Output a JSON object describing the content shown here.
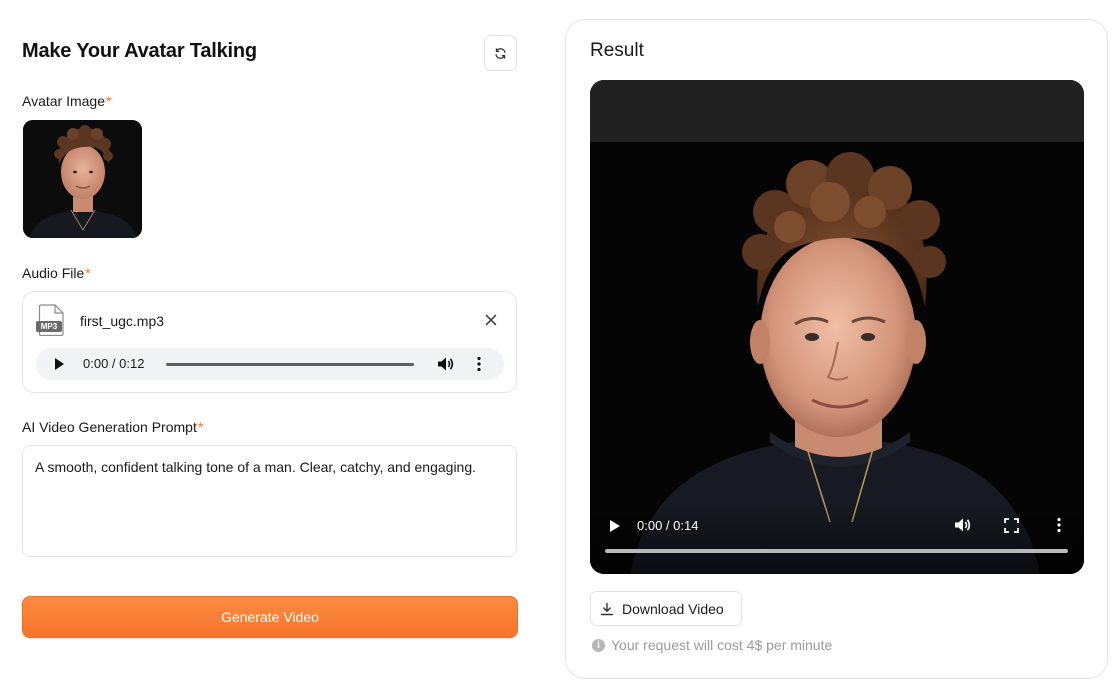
{
  "form": {
    "title": "Make Your Avatar Talking",
    "avatar_label": "Avatar Image",
    "audio_label": "Audio File",
    "prompt_label": "AI Video Generation Prompt",
    "required_mark": "*",
    "audio": {
      "file_name": "first_ugc.mp3",
      "file_badge": "MP3",
      "time": "0:00 / 0:12"
    },
    "prompt_value": "A smooth, confident talking tone of a man. Clear, catchy, and engaging.",
    "generate_label": "Generate Video"
  },
  "result": {
    "title": "Result",
    "video_time": "0:00 / 0:14",
    "download_label": "Download Video",
    "cost_icon": "i",
    "cost_text": "Your request will cost 4$ per minute"
  },
  "colors": {
    "accent": "#f57a2c",
    "button_gradient_top": "#fd8b43",
    "button_gradient_bottom": "#f5742a"
  },
  "icons": [
    "refresh-icon",
    "mp3-file-icon",
    "close-icon",
    "play-icon",
    "volume-icon",
    "more-vertical-icon",
    "fullscreen-icon",
    "download-icon",
    "info-icon"
  ]
}
